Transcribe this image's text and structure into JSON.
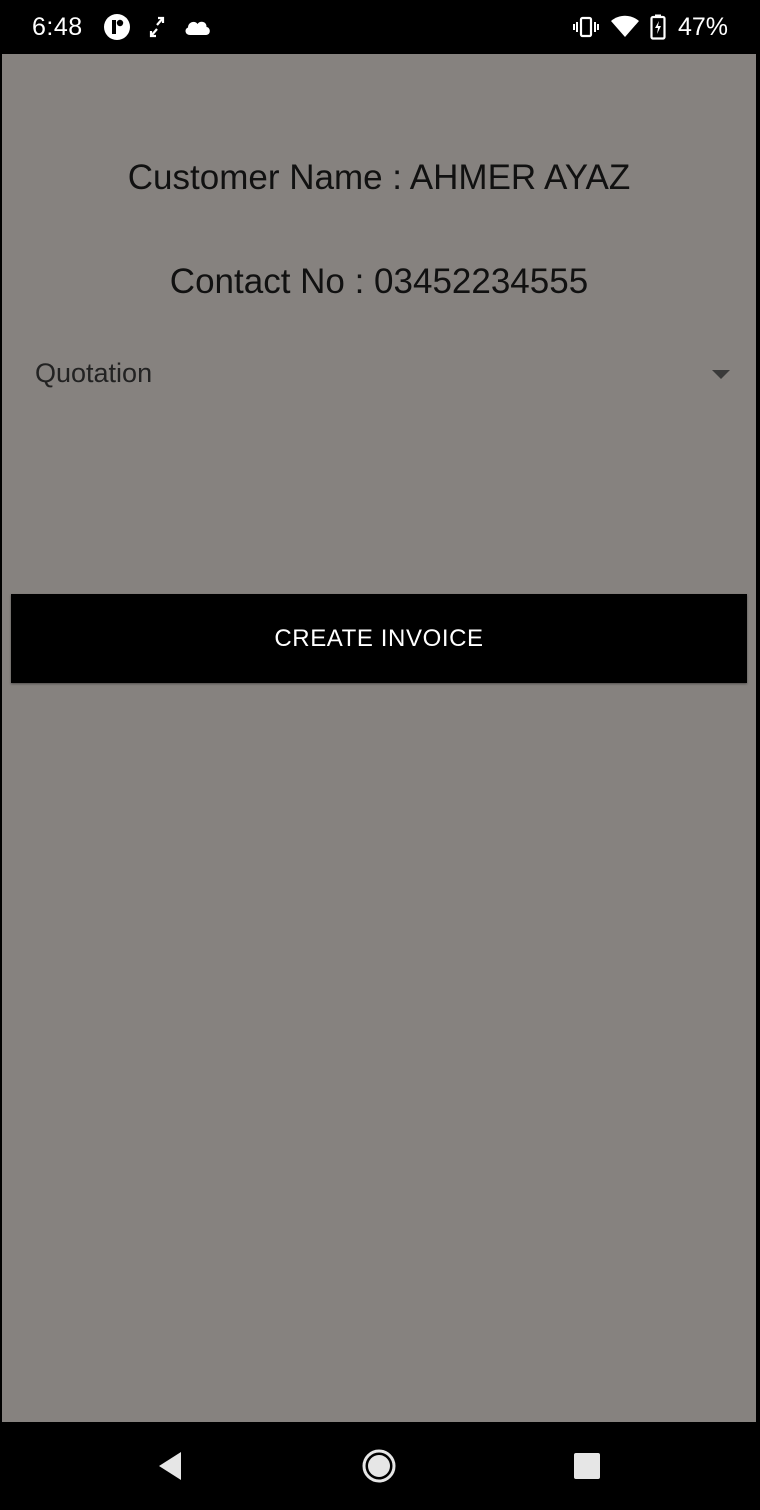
{
  "status_bar": {
    "time": "6:48",
    "battery_percent": "47%",
    "left_icons": [
      "notification-app-icon",
      "sync-icon",
      "cloud-icon"
    ],
    "right_icons": [
      "vibrate-icon",
      "wifi-icon",
      "battery-charging-icon"
    ]
  },
  "customer": {
    "name_line": "Customer Name : AHMER AYAZ",
    "contact_line": "Contact No : 03452234555"
  },
  "document_type": {
    "selected": "Quotation"
  },
  "actions": {
    "create_invoice_label": "CREATE INVOICE"
  },
  "nav_bar": {
    "icons": [
      "back-icon",
      "home-icon",
      "recents-icon"
    ]
  },
  "colors": {
    "content_background": "#86827f",
    "button_background": "#000000",
    "button_text": "#ffffff"
  }
}
